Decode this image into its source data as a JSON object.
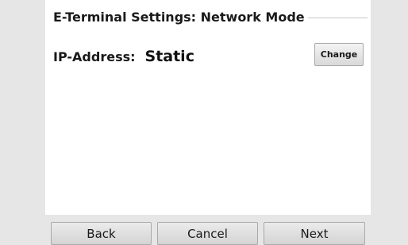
{
  "header": {
    "title": "E-Terminal Settings: Network Mode"
  },
  "ip_address": {
    "label": "IP-Address:",
    "value": "Static",
    "change_label": "Change"
  },
  "footer": {
    "back_label": "Back",
    "cancel_label": "Cancel",
    "next_label": "Next"
  }
}
